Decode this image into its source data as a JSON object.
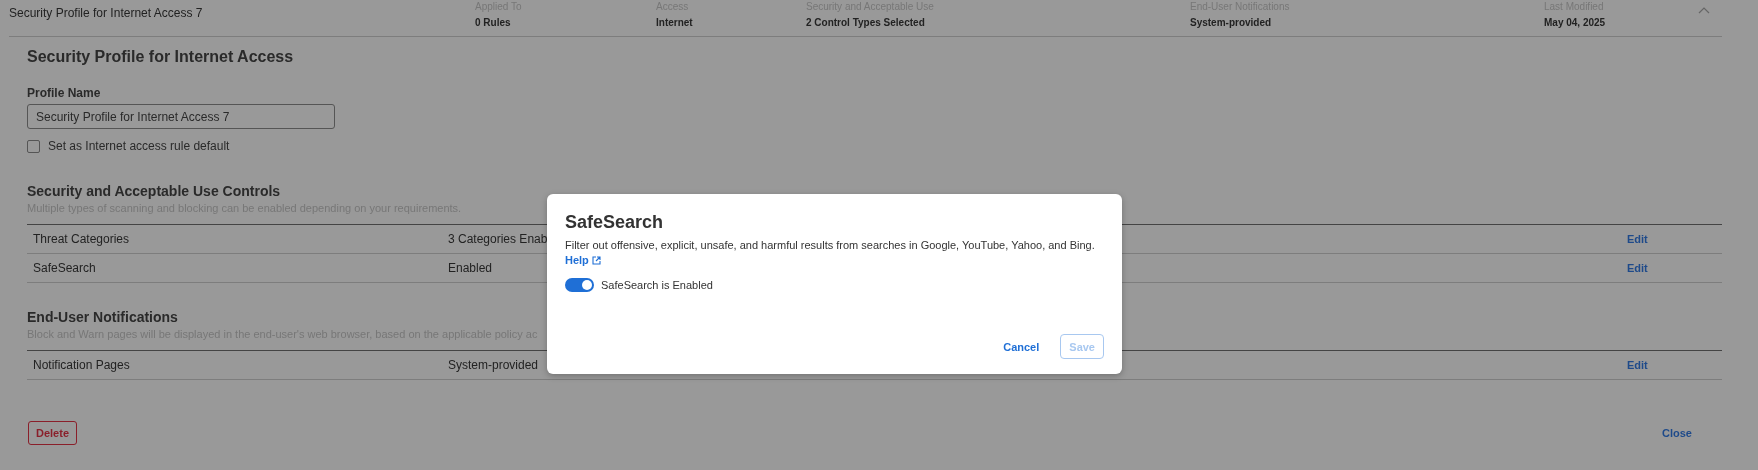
{
  "header": {
    "title": "Security Profile for Internet Access 7",
    "expanded": true,
    "columns": [
      {
        "label": "Applied To",
        "value": "0 Rules"
      },
      {
        "label": "Access",
        "value": "Internet"
      },
      {
        "label": "Security and Acceptable Use",
        "value": "2 Control Types Selected"
      },
      {
        "label": "End-User Notifications",
        "value": "System-provided"
      },
      {
        "label": "Last Modified",
        "value": "May 04, 2025"
      }
    ]
  },
  "form": {
    "heading": "Security Profile for Internet Access",
    "profile_name": {
      "label": "Profile Name",
      "value": "Security Profile for Internet Access 7"
    },
    "default_checkbox": {
      "label": "Set as Internet access rule default",
      "checked": false
    }
  },
  "sections": [
    {
      "heading": "Security and Acceptable Use Controls",
      "description": "Multiple types of scanning and blocking can be enabled depending on your requirements.",
      "rows": [
        {
          "name": "Threat Categories",
          "value": "3 Categories Enab",
          "action": "Edit"
        },
        {
          "name": "SafeSearch",
          "value": "Enabled",
          "action": "Edit"
        }
      ]
    },
    {
      "heading": "End-User Notifications",
      "description": "Block and Warn pages will be displayed in the end-user's web browser, based on the applicable policy ac",
      "rows": [
        {
          "name": "Notification Pages",
          "value": "System-provided",
          "action": "Edit"
        }
      ]
    }
  ],
  "delete_button": "Delete",
  "close_button": "Close",
  "dialog": {
    "title": "SafeSearch",
    "description": "Filter out offensive, explicit, unsafe, and harmful results from searches in Google, YouTube, Yahoo, and Bing.",
    "help_link": "Help",
    "toggle": {
      "label": "SafeSearch is Enabled",
      "on": true
    },
    "buttons": [
      {
        "label": "Cancel",
        "disabled": false
      },
      {
        "label": "Save",
        "disabled": true
      }
    ]
  }
}
